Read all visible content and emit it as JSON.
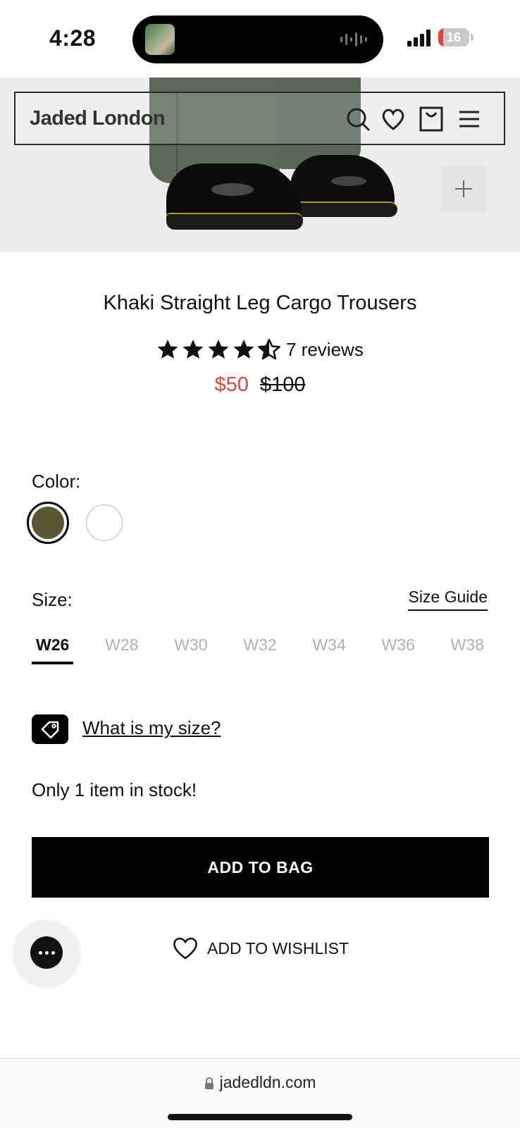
{
  "status_bar": {
    "time": "4:28",
    "battery": "16",
    "battery_level": 0.16,
    "battery_color": "#ee3b33"
  },
  "header": {
    "logo": "Jaded London"
  },
  "product": {
    "title": "Khaki Straight Leg Cargo Trousers",
    "rating": 4.5,
    "reviews": "7 reviews",
    "sale_price": "$50",
    "original_price": "$100",
    "sale_color": "#e0463c"
  },
  "color": {
    "label": "Color:",
    "swatches": [
      {
        "name": "khaki",
        "hex": "#5a5632",
        "selected": true
      },
      {
        "name": "white",
        "hex": "#ffffff",
        "selected": false
      }
    ]
  },
  "size": {
    "label": "Size:",
    "guide": "Size Guide",
    "options": [
      "W26",
      "W28",
      "W30",
      "W32",
      "W34",
      "W36",
      "W38"
    ],
    "selected": "W26",
    "help": "What is my size?"
  },
  "stock": "Only 1 item in stock!",
  "actions": {
    "add_to_bag": "ADD TO BAG",
    "add_to_wishlist": "ADD TO WISHLIST"
  },
  "browser": {
    "url": "jadedldn.com"
  },
  "icons": [
    "search-icon",
    "heart-icon",
    "bag-icon",
    "menu-icon",
    "plus-icon",
    "chat-icon",
    "tag-icon",
    "lock-icon"
  ]
}
